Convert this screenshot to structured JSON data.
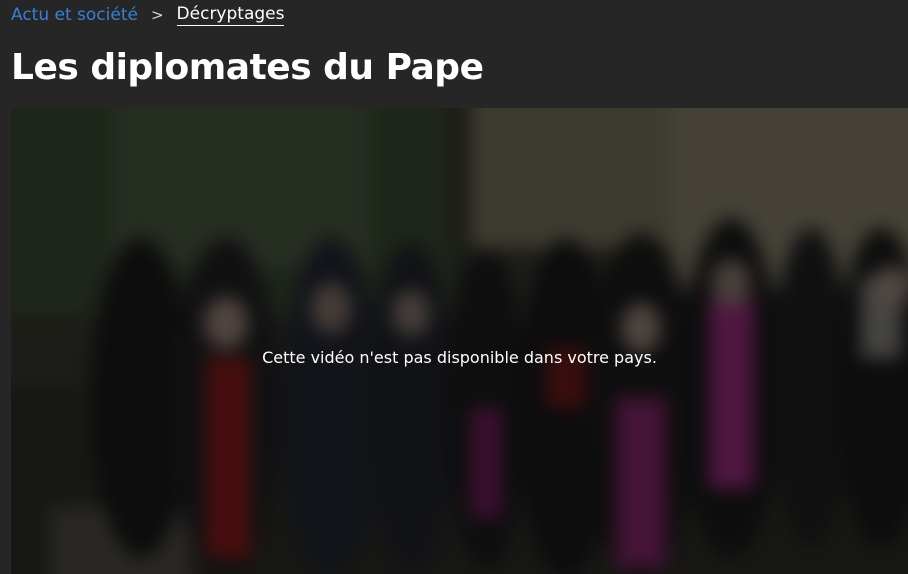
{
  "breadcrumb": {
    "parent_label": "Actu et société",
    "separator": ">",
    "current_label": "Décryptages"
  },
  "page": {
    "title": "Les diplomates du Pape"
  },
  "video": {
    "message": "Cette vidéo n'est pas disponible dans votre pays."
  },
  "colors": {
    "background": "#262626",
    "link": "#3a7fd5",
    "text": "#ffffff"
  }
}
